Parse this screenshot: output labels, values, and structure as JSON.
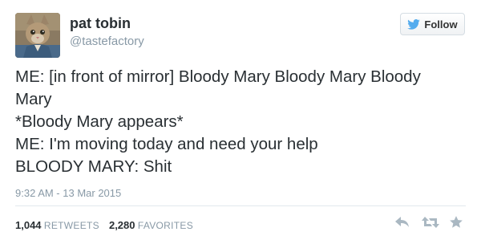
{
  "user": {
    "name": "pat tobin",
    "handle": "@tastefactory"
  },
  "follow": {
    "label": "Follow"
  },
  "tweet": {
    "lines": [
      "ME: [in front of mirror] Bloody Mary Bloody Mary Bloody",
      "Mary",
      "*Bloody Mary appears*",
      "ME: I'm moving today and need your help",
      "BLOODY MARY: Shit"
    ],
    "timestamp": "9:32 AM - 13 Mar 2015"
  },
  "stats": {
    "retweets_count": "1,044",
    "retweets_label": "RETWEETS",
    "favorites_count": "2,280",
    "favorites_label": "FAVORITES"
  },
  "actions": {
    "icons": [
      "reply-icon",
      "retweet-icon",
      "favorite-icon"
    ]
  },
  "colors": {
    "text": "#292f33",
    "muted": "#8899a6",
    "twitter_blue": "#55acee",
    "divider": "#e1e8ed"
  }
}
